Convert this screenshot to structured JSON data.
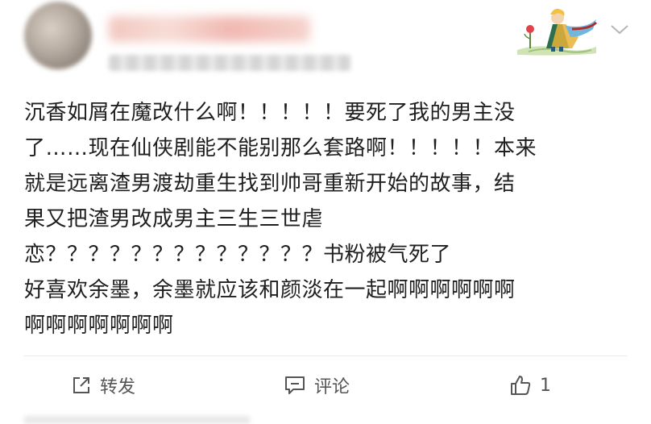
{
  "post": {
    "body_lines": [
      "沉香如屑在魔改什么啊！！！！！要死了我的男主没",
      "了……现在仙侠剧能不能别那么套路啊！！！！！本来",
      "就是远离渣男渡劫重生找到帅哥重新开始的故事，结",
      "果又把渣男改成男主三生三世虐",
      "恋？？？？？？？？？？？？？书粉被气死了",
      "好喜欢余墨，余墨就应该和颜淡在一起啊啊啊啊啊啊",
      "啊啊啊啊啊啊啊"
    ]
  },
  "actions": {
    "repost_label": "转发",
    "comment_label": "评论",
    "like_count": "1"
  },
  "icons": {
    "repost": "share-square-icon",
    "comment": "comment-dots-icon",
    "like": "thumbs-up-icon",
    "more": "chevron-down-icon",
    "sticker": "little-prince-sticker-icon"
  },
  "colors": {
    "text": "#1f1f1f",
    "action_text": "#555555",
    "divider": "#e9e9e9"
  }
}
